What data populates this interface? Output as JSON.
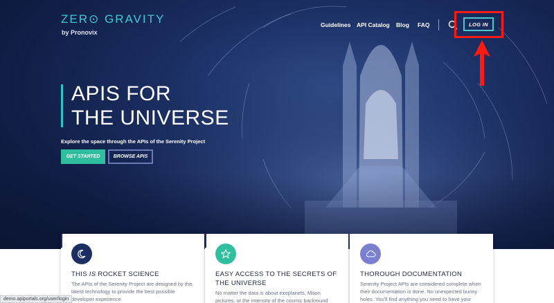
{
  "header": {
    "logo": "ZER⊙ GRAVITY",
    "logo_sub": "by Pronovix",
    "nav": [
      "Guidelines",
      "API Catalog",
      "Blog",
      "FAQ"
    ],
    "login_label": "LOG IN"
  },
  "hero": {
    "title_line1": "APIS FOR",
    "title_line2": "THE UNIVERSE",
    "subtitle": "Explore the space through the APIs of the Serenity Project",
    "get_started": "GET STARTED",
    "browse_apis": "BROWSE APIS"
  },
  "cards": [
    {
      "icon": "moon-icon",
      "title_pre": "THIS ",
      "title_em": "IS",
      "title_post": " ROCKET SCIENCE",
      "text": "The APIs of the Serenity Project are designed by the latest technology to provide the best possible developer experience.",
      "color": "#1c2f63"
    },
    {
      "icon": "star-icon",
      "title": "EASY ACCESS TO THE SECRETS OF THE UNIVERSE",
      "text": "No matter the data is about exoplanets, Moon pictures, or the intensity of the cosmic backround",
      "color": "#2fbf9f"
    },
    {
      "icon": "cloud-icon",
      "title": "THOROUGH DOCUMENTATION",
      "text": "Serenity Project APIs are considered complete when their documentation is done. No unexpected bunny holes. You'll find anything you need to have your",
      "color": "#7a7fd0"
    }
  ],
  "status_url": "demo.apiportals.org/user/login",
  "colors": {
    "accent_teal": "#2fbf9f",
    "highlight_red": "#ff1a12",
    "navy": "#1c2f63"
  }
}
